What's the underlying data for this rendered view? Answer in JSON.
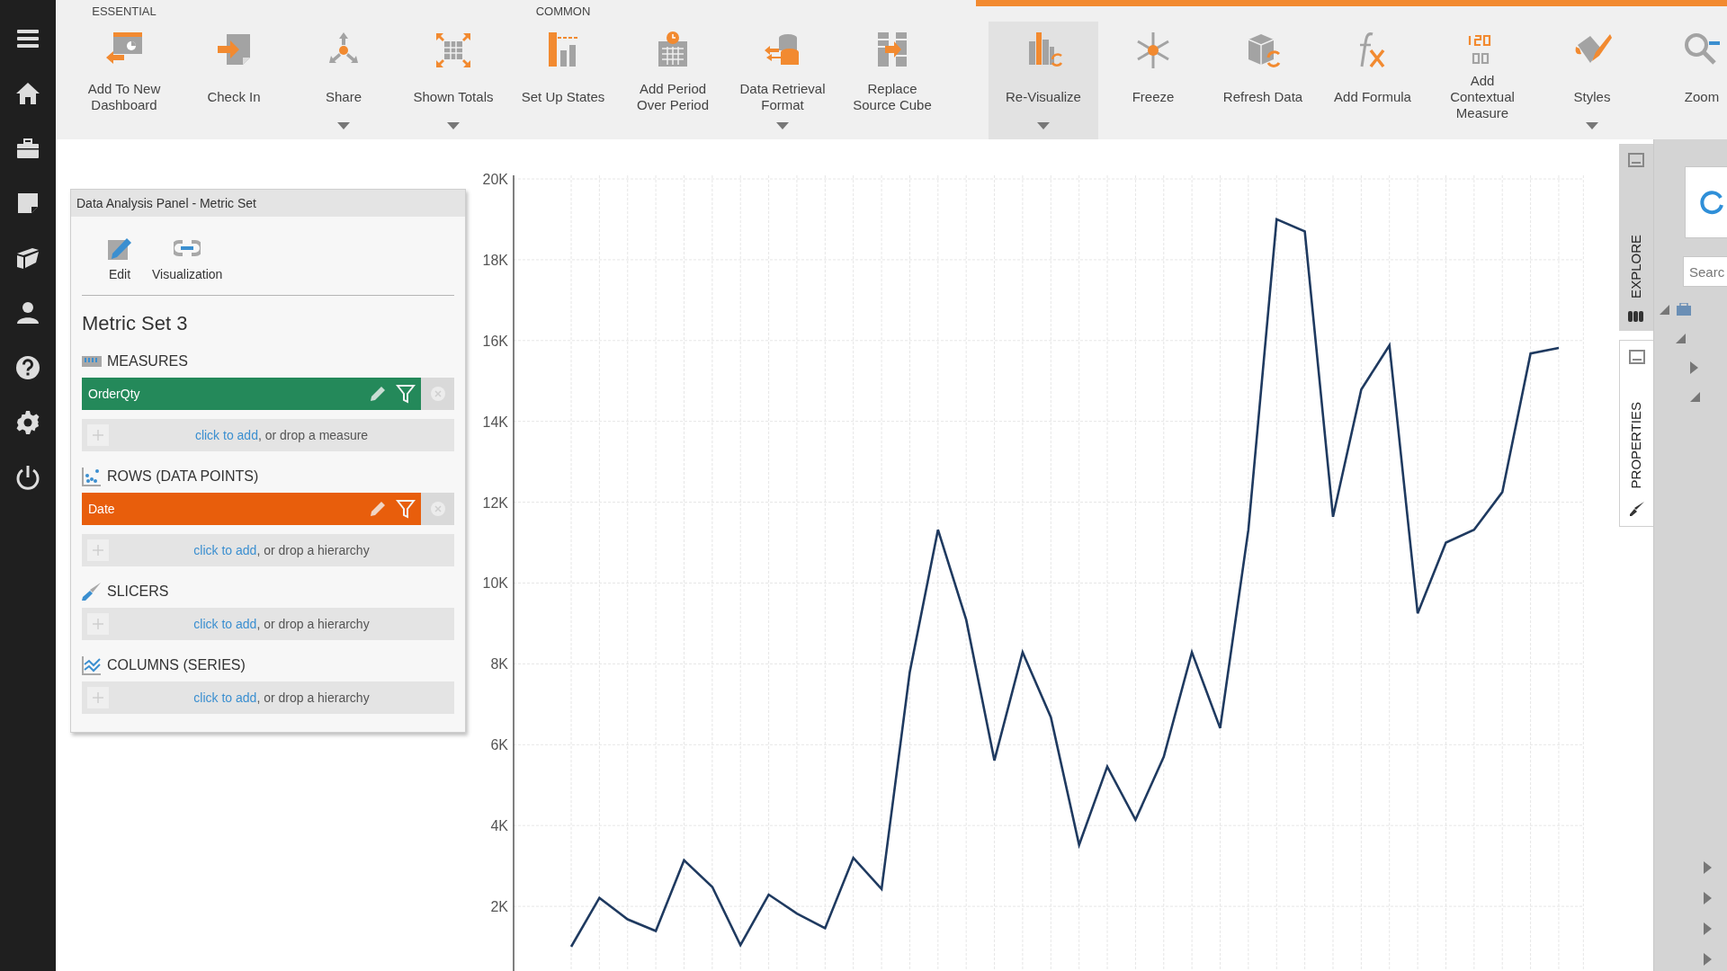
{
  "toolbar": {
    "section_labels": [
      {
        "text": "ESSENTIAL"
      },
      {
        "text": "COMMON"
      }
    ],
    "groups": [
      {
        "items": [
          {
            "label": "Add To New\nDashboard",
            "dropdown": false,
            "selected": false
          },
          {
            "label": "Check In",
            "dropdown": false,
            "selected": false
          },
          {
            "label": "Share",
            "dropdown": true,
            "selected": false
          },
          {
            "label": "Shown Totals",
            "dropdown": true,
            "selected": false
          },
          {
            "label": "Set Up States",
            "dropdown": false,
            "selected": false
          },
          {
            "label": "Add Period\nOver Period",
            "dropdown": false,
            "selected": false
          },
          {
            "label": "Data Retrieval\nFormat",
            "dropdown": true,
            "selected": false
          },
          {
            "label": "Replace\nSource Cube",
            "dropdown": false,
            "selected": false
          }
        ]
      },
      {
        "items": [
          {
            "label": "Re-Visualize",
            "dropdown": true,
            "selected": true
          },
          {
            "label": "Freeze",
            "dropdown": false,
            "selected": false
          },
          {
            "label": "Refresh Data",
            "dropdown": false,
            "selected": false
          },
          {
            "label": "Add Formula",
            "dropdown": false,
            "selected": false
          },
          {
            "label": "Add\nContextual\nMeasure",
            "dropdown": false,
            "selected": false
          },
          {
            "label": "Styles",
            "dropdown": true,
            "selected": false
          },
          {
            "label": "Zoom",
            "dropdown": false,
            "selected": false
          }
        ]
      }
    ]
  },
  "analysis_panel": {
    "title": "Data Analysis Panel - Metric Set",
    "buttons": [
      {
        "label": "Edit"
      },
      {
        "label": "Visualization"
      }
    ],
    "heading": "Metric Set 3",
    "sections": [
      {
        "label": "MEASURES",
        "fields": [
          {
            "label": "OrderQty",
            "color": "#24895a"
          }
        ],
        "link": "click to add",
        "hint": ", or drop a measure"
      },
      {
        "label": "ROWS (DATA POINTS)",
        "fields": [
          {
            "label": "Date",
            "color": "#e85e0c"
          }
        ],
        "link": "click to add",
        "hint": ", or drop a hierarchy"
      },
      {
        "label": "SLICERS",
        "link": "click to add",
        "hint": ", or drop a hierarchy"
      },
      {
        "label": "COLUMNS (SERIES)",
        "link": "click to add",
        "hint": ", or drop a hierarchy"
      }
    ]
  },
  "chart": {
    "chart_data": {
      "type": "line",
      "grid": true,
      "ylim": [
        400,
        20000
      ],
      "yticks": [
        {
          "value": 2000,
          "label": "2K"
        },
        {
          "value": 4000,
          "label": "4K"
        },
        {
          "value": 6000,
          "label": "6K"
        },
        {
          "value": 8000,
          "label": "8K"
        },
        {
          "value": 10000,
          "label": "10K"
        },
        {
          "value": 12000,
          "label": "12K"
        },
        {
          "value": 14000,
          "label": "14K"
        },
        {
          "value": 16000,
          "label": "16K"
        },
        {
          "value": 18000,
          "label": "18K"
        },
        {
          "value": 20000,
          "label": "20K"
        }
      ],
      "series": [
        {
          "color": "#1f3a60",
          "values": [
            1000,
            2210,
            1680,
            1390,
            3140,
            2480,
            1040,
            2290,
            1820,
            1460,
            3200,
            2430,
            7790,
            11320,
            9090,
            5610,
            8290,
            6680,
            3520,
            5460,
            4140,
            5700,
            8290,
            6410,
            11320,
            19000,
            18700,
            11640,
            14790,
            15880,
            9250,
            11000,
            11320,
            12250,
            15680,
            15820
          ]
        }
      ]
    }
  },
  "side_tabs": [
    {
      "label": "EXPLORE",
      "selected": true
    },
    {
      "label": "PROPERTIES",
      "selected": false
    }
  ],
  "explore_panel": {
    "search": {
      "placeholder": "Searc"
    }
  }
}
